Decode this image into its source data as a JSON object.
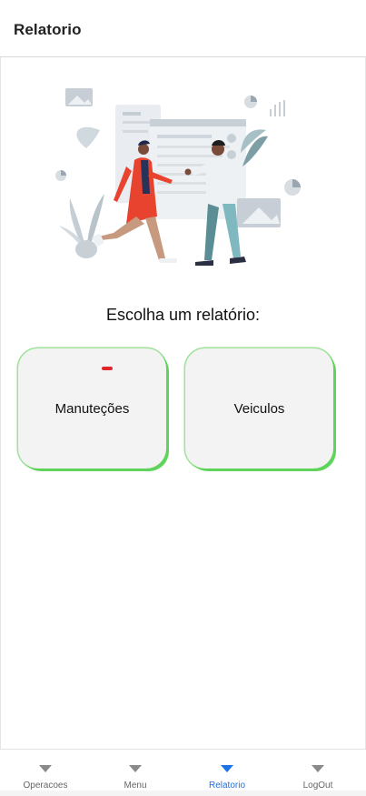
{
  "header": {
    "title": "Relatorio"
  },
  "main": {
    "illustration_name": "report-discussion-illustration",
    "prompt": "Escolha um relatório:",
    "cards": [
      {
        "label": "Manuteções",
        "badge_color": "#e0262b"
      },
      {
        "label": "Veiculos"
      }
    ],
    "card_accent_color": "#5fd45a"
  },
  "bottom_nav": {
    "items": [
      {
        "label": "Operacoes",
        "icon": "triangle-down-icon"
      },
      {
        "label": "Menu",
        "icon": "triangle-down-icon"
      },
      {
        "label": "Relatorio",
        "icon": "triangle-down-icon",
        "active": true
      },
      {
        "label": "LogOut",
        "icon": "triangle-down-icon"
      }
    ],
    "active_color": "#1a73e8"
  }
}
